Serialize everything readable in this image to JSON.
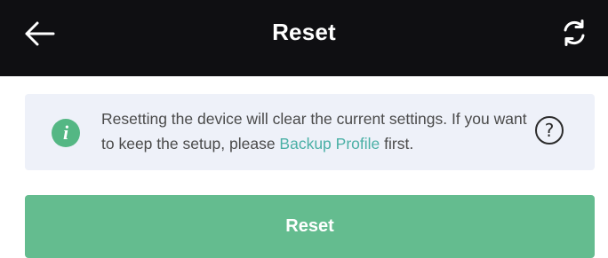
{
  "header": {
    "title": "Reset",
    "back_icon": "arrow-left-icon",
    "refresh_icon": "refresh-icon"
  },
  "notice": {
    "icon": "info-icon",
    "icon_glyph": "i",
    "text_before": "Resetting the device will clear the current settings. If you want to keep the setup, please ",
    "link": "Backup Profile",
    "text_after": " first.",
    "help_icon": "question-circle-icon",
    "help_glyph": "?"
  },
  "action": {
    "reset_label": "Reset"
  },
  "colors": {
    "topbar_bg": "#0f0f12",
    "notice_bg": "#eef1f9",
    "info_green": "#54b784",
    "link": "#4bb0a6",
    "button_bg": "#64bc8f"
  }
}
